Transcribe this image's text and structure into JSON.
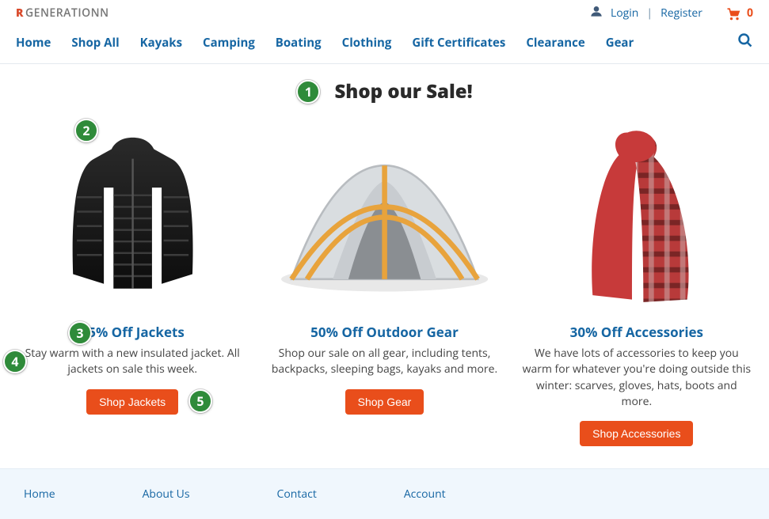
{
  "logo": {
    "mark": "R",
    "text": "GENERATIONN"
  },
  "topbar": {
    "login": "Login",
    "register": "Register",
    "divider": "|",
    "cart_count": "0"
  },
  "nav": {
    "items": [
      "Home",
      "Shop All",
      "Kayaks",
      "Camping",
      "Boating",
      "Clothing",
      "Gift Certificates",
      "Clearance",
      "Gear"
    ]
  },
  "hero": {
    "title": "Shop our Sale!"
  },
  "cards": [
    {
      "title": "25% Off Jackets",
      "desc": "Stay warm with a new insulated jacket. All jackets on sale this week.",
      "cta": "Shop Jackets"
    },
    {
      "title": "50% Off Outdoor Gear",
      "desc": "Shop our sale on all gear, including tents, backpacks, sleeping bags, kayaks and more.",
      "cta": "Shop Gear"
    },
    {
      "title": "30% Off Accessories",
      "desc": "We have lots of accessories to keep you warm for whatever you're doing outside this winter: scarves, gloves, hats, boots and more.",
      "cta": "Shop Accessories"
    }
  ],
  "footer": {
    "links": [
      "Home",
      "About Us",
      "Contact",
      "Account"
    ]
  },
  "annotations": {
    "b1": "1",
    "b2": "2",
    "b3": "3",
    "b4": "4",
    "b5": "5"
  }
}
